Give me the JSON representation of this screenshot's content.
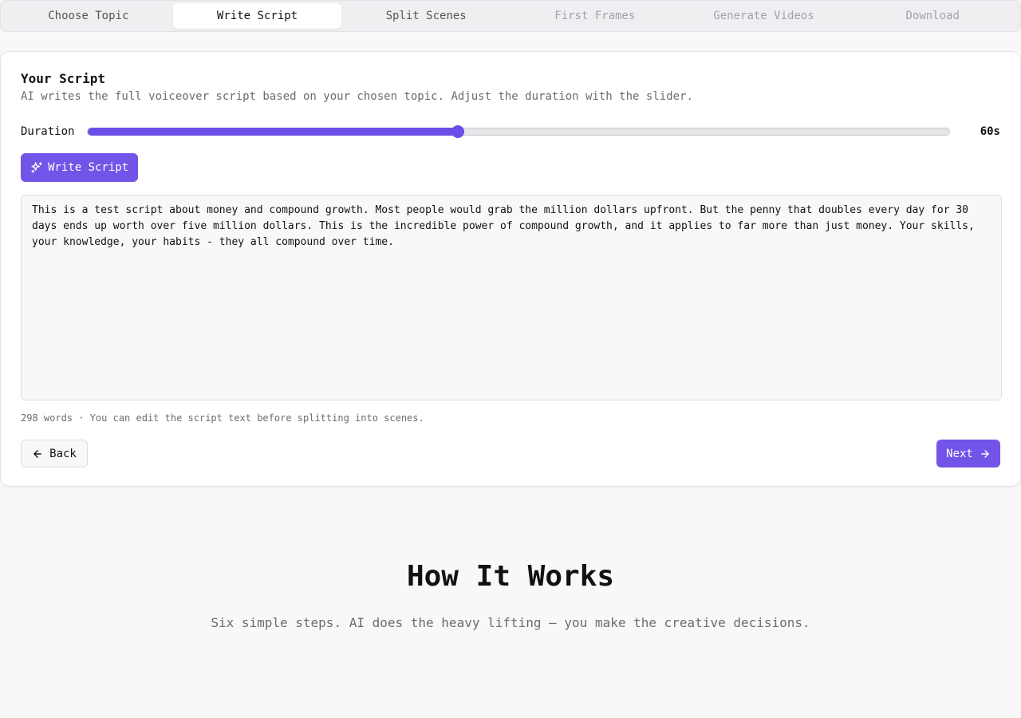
{
  "tabs": [
    {
      "label": "Choose Topic",
      "state": "completed"
    },
    {
      "label": "Write Script",
      "state": "active"
    },
    {
      "label": "Split Scenes",
      "state": "completed"
    },
    {
      "label": "First Frames",
      "state": "disabled"
    },
    {
      "label": "Generate Videos",
      "state": "disabled"
    },
    {
      "label": "Download",
      "state": "disabled"
    }
  ],
  "card": {
    "title": "Your Script",
    "description": "AI writes the full voiceover script based on your chosen topic. Adjust the duration with the slider.",
    "duration_label": "Duration",
    "duration_value": "60s",
    "duration_fraction": 0.43,
    "write_button_label": "Write Script",
    "script_text": "This is a test script about money and compound growth. Most people would grab the million dollars upfront. But the penny that doubles every day for 30 days ends up worth over five million dollars. This is the incredible power of compound growth, and it applies to far more than just money. Your skills, your knowledge, your habits - they all compound over time.",
    "word_info": "298 words · You can edit the script text before splitting into scenes.",
    "back_label": "Back",
    "next_label": "Next"
  },
  "how_it_works": {
    "title": "How It Works",
    "subtitle": "Six simple steps. AI does the heavy lifting — you make the creative decisions."
  },
  "colors": {
    "accent": "#7254e8",
    "slider": "#6b4ee6"
  }
}
